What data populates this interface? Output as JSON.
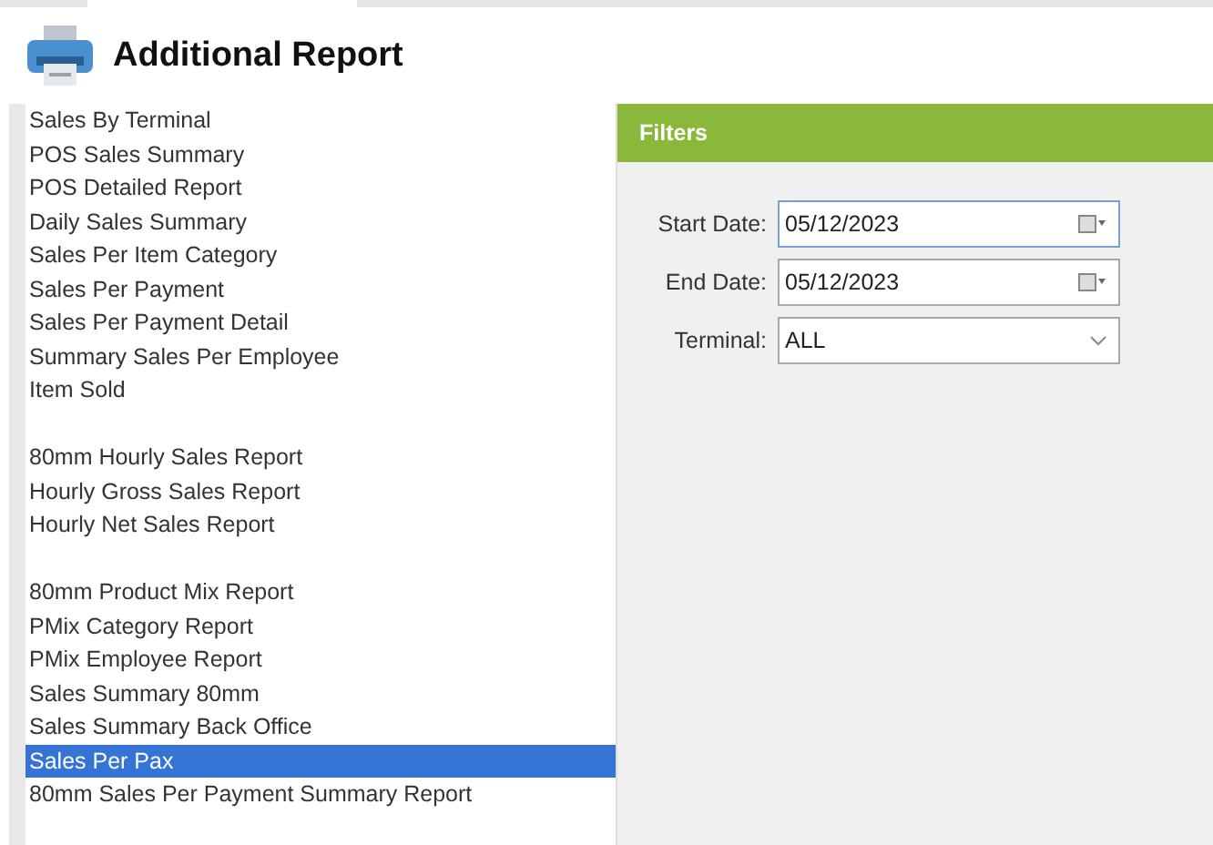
{
  "header": {
    "title": "Additional Report"
  },
  "report_groups": [
    {
      "items": [
        {
          "label": "Sales By Terminal",
          "selected": false
        },
        {
          "label": "POS Sales Summary",
          "selected": false
        },
        {
          "label": "POS Detailed Report",
          "selected": false
        },
        {
          "label": "Daily Sales Summary",
          "selected": false
        },
        {
          "label": "Sales Per Item Category",
          "selected": false
        },
        {
          "label": "Sales Per Payment",
          "selected": false
        },
        {
          "label": "Sales Per Payment Detail",
          "selected": false
        },
        {
          "label": "Summary Sales Per Employee",
          "selected": false
        },
        {
          "label": "Item Sold",
          "selected": false
        }
      ]
    },
    {
      "items": [
        {
          "label": "80mm Hourly Sales Report",
          "selected": false
        },
        {
          "label": "Hourly Gross Sales Report",
          "selected": false
        },
        {
          "label": "Hourly Net Sales Report",
          "selected": false
        }
      ]
    },
    {
      "items": [
        {
          "label": "80mm Product Mix Report",
          "selected": false
        },
        {
          "label": "PMix Category Report",
          "selected": false
        },
        {
          "label": "PMix Employee Report",
          "selected": false
        },
        {
          "label": "Sales Summary 80mm",
          "selected": false
        },
        {
          "label": "Sales Summary Back Office",
          "selected": false
        },
        {
          "label": "Sales Per Pax",
          "selected": true
        },
        {
          "label": "80mm Sales Per Payment Summary Report",
          "selected": false
        }
      ]
    }
  ],
  "filters": {
    "title": "Filters",
    "fields": [
      {
        "kind": "date",
        "label": "Start Date:",
        "value": "05/12/2023",
        "focused": true
      },
      {
        "kind": "date",
        "label": "End Date:",
        "value": "05/12/2023",
        "focused": false
      },
      {
        "kind": "select",
        "label": "Terminal:",
        "value": "ALL",
        "focused": false
      }
    ]
  }
}
